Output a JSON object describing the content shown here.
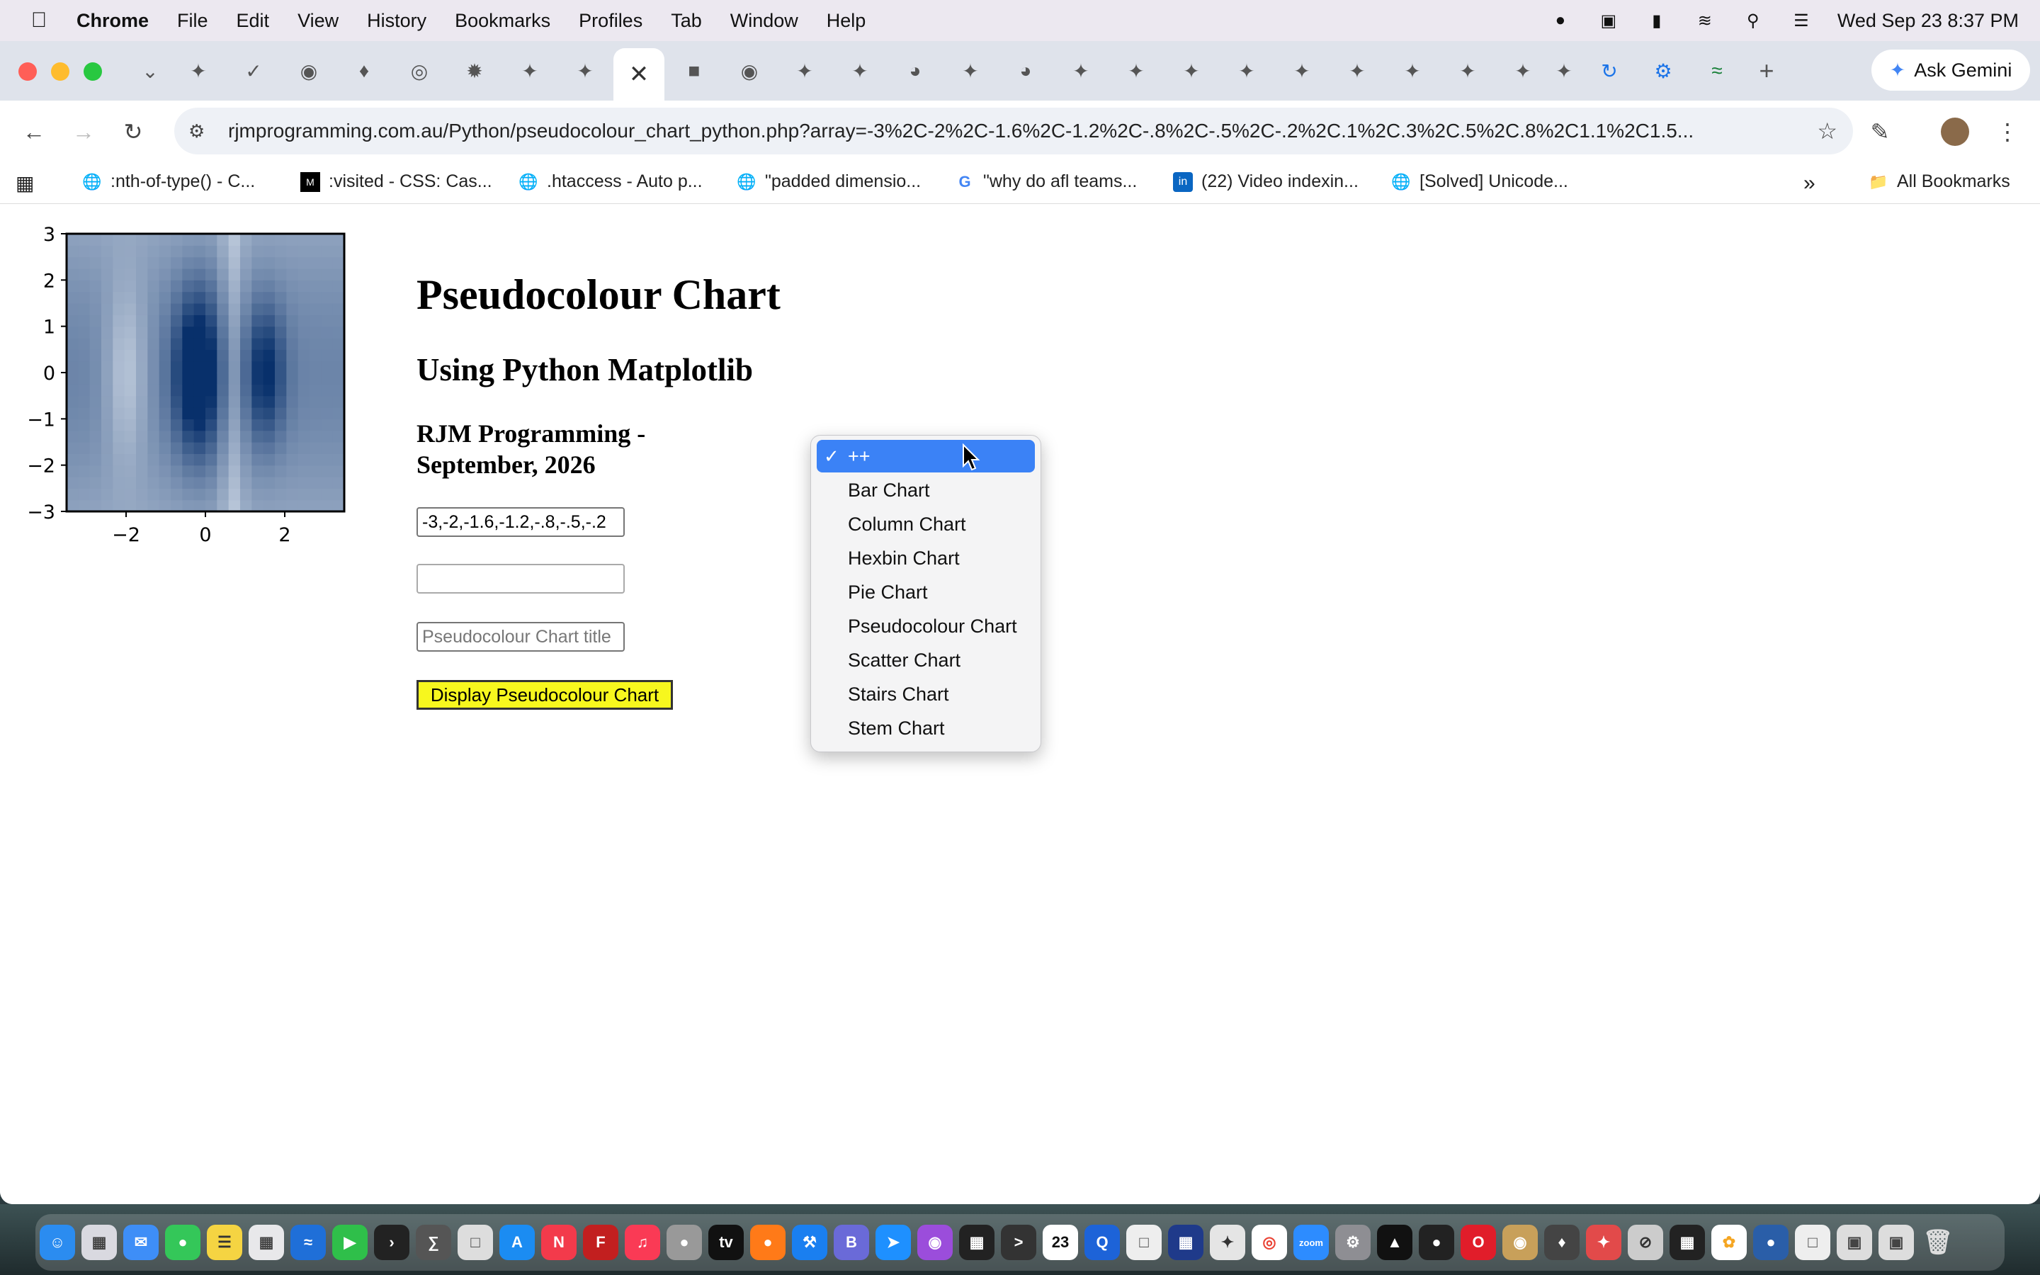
{
  "menubar": {
    "app": "Chrome",
    "menus": [
      "File",
      "Edit",
      "View",
      "History",
      "Bookmarks",
      "Profiles",
      "Tab",
      "Window",
      "Help"
    ],
    "clock": "Wed Sep 23  8:37 PM"
  },
  "tabs": {
    "active_close_glyph": "✕",
    "new_tab_glyph": "+",
    "gemini_label": "Ask Gemini"
  },
  "toolbar": {
    "url": "rjmprogramming.com.au/Python/pseudocolour_chart_python.php?array=-3%2C-2%2C-1.6%2C-1.2%2C-.8%2C-.5%2C-.2%2C.1%2C.3%2C.5%2C.8%2C1.1%2C1.5..."
  },
  "bookmarks": {
    "items": [
      ":nth-of-type() - C...",
      ":visited - CSS: Cas...",
      ".htaccess - Auto p...",
      "\"padded dimensio...",
      "\"why do afl teams...",
      "(22) Video indexin...",
      "[Solved] Unicode..."
    ],
    "all_bookmarks": "All Bookmarks"
  },
  "page": {
    "title": "Pseudocolour Chart",
    "subtitle": "Using Python Matplotlib",
    "author": "RJM Programming - September, 2026",
    "array_value": "-3,-2,-1.6,-1.2,-.8,-.5,-.2",
    "extra_value": "",
    "title_placeholder": "Pseudocolour Chart title",
    "display_button": "Display Pseudocolour Chart"
  },
  "dropdown": {
    "selected": "++",
    "options": [
      "++",
      "Bar Chart",
      "Column Chart",
      "Hexbin Chart",
      "Pie Chart",
      "Pseudocolour Chart",
      "Scatter Chart",
      "Stairs Chart",
      "Stem Chart"
    ]
  },
  "chart_data": {
    "type": "heatmap",
    "title": "",
    "xlabel": "",
    "ylabel": "",
    "xlim": [
      -3.5,
      3.5
    ],
    "ylim": [
      -3,
      3
    ],
    "xticks": [
      "−2",
      "0",
      "2"
    ],
    "yticks": [
      "3",
      "2",
      "1",
      "0",
      "−1",
      "−2",
      "−3"
    ],
    "colormap": "Blues",
    "grid": false
  },
  "colors": {
    "selected_option": "#3b82f6",
    "display_button_bg": "#f7f71e",
    "heatmap_light": "#f7fbff",
    "heatmap_dark": "#08306b"
  }
}
